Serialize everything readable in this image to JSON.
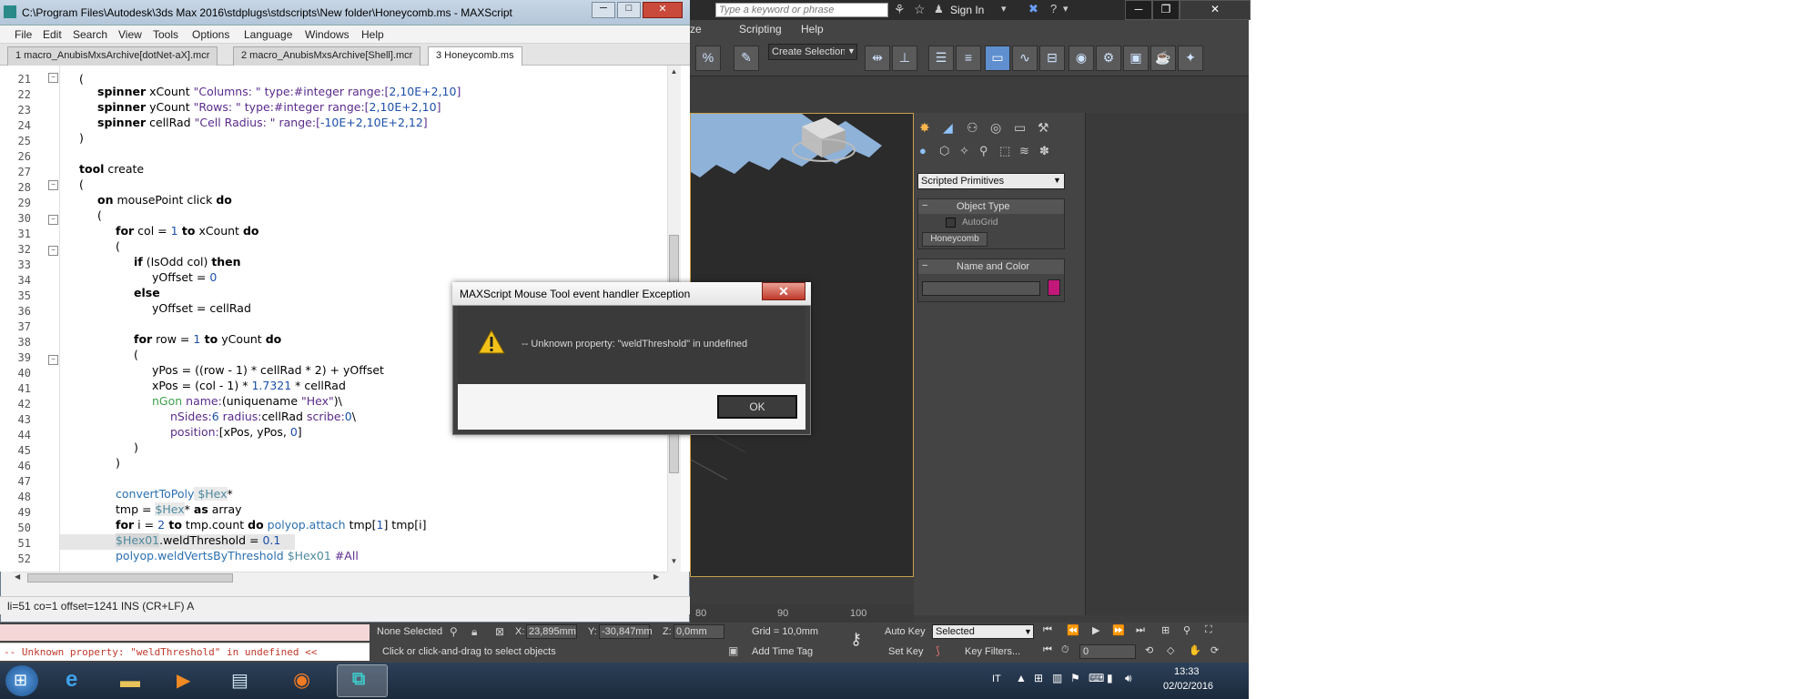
{
  "max": {
    "search_placeholder": "Type a keyword or phrase",
    "sign_in": "Sign In",
    "menu": [
      "Scripting",
      "Help"
    ],
    "selection_set": "Create Selection Se",
    "panel_dropdown": "Scripted Primitives",
    "object_type_header": "Object Type",
    "autogrid_label": "AutoGrid",
    "honeycomb_button": "Honeycomb",
    "name_color_header": "Name and Color",
    "name_color_swatch": "#c2187a",
    "ruler": [
      "80",
      "90",
      "100"
    ],
    "status": {
      "selection": "None Selected",
      "x_label": "X:",
      "x_value": "23,895mm",
      "y_label": "Y:",
      "y_value": "-30,847mm",
      "z_label": "Z:",
      "z_value": "0,0mm",
      "grid": "Grid = 10,0mm",
      "prompt": "Click or click-and-drag to select objects",
      "add_time_tag": "Add Time Tag",
      "auto_key": "Auto Key",
      "set_key": "Set Key",
      "selected_dropdown": "Selected",
      "key_filters": "Key Filters...",
      "frame": "0"
    },
    "listener_error": "-- Unknown property: \"weldThreshold\" in undefined <<"
  },
  "editor": {
    "title": "C:\\Program Files\\Autodesk\\3ds Max 2016\\stdplugs\\stdscripts\\New folder\\Honeycomb.ms - MAXScript",
    "menu": [
      "File",
      "Edit",
      "Search",
      "View",
      "Tools",
      "Options",
      "Language",
      "Windows",
      "Help"
    ],
    "tabs": [
      "1 macro_AnubisMxsArchive[dotNet-aX].mcr",
      "2 macro_AnubisMxsArchive[Shell].mcr",
      "3 Honeycomb.ms"
    ],
    "status": "li=51 co=1 offset=1241 INS (CR+LF) A",
    "line_numbers": [
      "21",
      "22",
      "23",
      "24",
      "25",
      "26",
      "27",
      "28",
      "29",
      "30",
      "31",
      "32",
      "33",
      "34",
      "35",
      "36",
      "37",
      "38",
      "39",
      "40",
      "41",
      "42",
      "43",
      "44",
      "45",
      "46",
      "47",
      "48",
      "49",
      "50",
      "51",
      "52"
    ],
    "code": {
      "l21": "(",
      "l22_kw": "spinner",
      "l22_name": " xCount ",
      "l22_str": "\"Columns: \"",
      "l22_type": " type:#integer range:[",
      "l22_nums": "2,10E+2,10",
      "l22_end": "]",
      "l23_kw": "spinner",
      "l23_name": " yCount ",
      "l23_str": "\"Rows: \"",
      "l23_type": " type:#integer range:[",
      "l23_nums": "2,10E+2,10",
      "l23_end": "]",
      "l24_kw": "spinner",
      "l24_name": " cellRad ",
      "l24_str": "\"Cell Radius: \"",
      "l24_type": " range:[",
      "l24_nums": "-10E+2,10E+2,12",
      "l24_end": "]",
      "l25": ")",
      "l27_kw": "tool",
      "l27_rest": " create",
      "l28": "(",
      "l29_kw1": "on",
      "l29_mid": " mousePoint click ",
      "l29_kw2": "do",
      "l30": "(",
      "l31_kw1": "for",
      "l31_a": " col = ",
      "l31_num": "1",
      "l31_kw2": " to",
      "l31_b": " xCount ",
      "l31_kw3": "do",
      "l32": "(",
      "l33_kw1": "if",
      "l33_a": " (IsOdd col) ",
      "l33_kw2": "then",
      "l34_a": "yOffset = ",
      "l34_num": "0",
      "l35_kw": "else",
      "l36": "yOffset = cellRad",
      "l38_kw1": "for",
      "l38_a": " row = ",
      "l38_num": "1",
      "l38_kw2": " to",
      "l38_b": " yCount ",
      "l38_kw3": "do",
      "l39": "(",
      "l40": "yPos = ((row - 1) * cellRad * 2) + yOffset",
      "l41_a": "xPos = (col - 1) * ",
      "l41_num": "1.7321",
      "l41_b": " * cellRad",
      "l42_fn": "nGon",
      "l42_a": " name:",
      "l42_b": "(uniquename ",
      "l42_str": "\"Hex\"",
      "l42_c": ")\\",
      "l43_a": "nSides:",
      "l43_n1": "6",
      "l43_b": " radius:",
      "l43_c": "cellRad",
      "l43_d": " scribe:",
      "l43_n2": "0",
      "l43_e": "\\",
      "l44_a": "position:",
      "l44_b": "[xPos, yPos, ",
      "l44_num": "0",
      "l44_c": "]",
      "l45": ")",
      "l46": ")",
      "l48_fn": "convertToPoly",
      "l48_nm": " $Hex",
      "l48_end": "*",
      "l49_a": "tmp = ",
      "l49_nm": "$Hex",
      "l49_b": "* ",
      "l49_kw": "as",
      "l49_c": " array",
      "l50_kw1": "for",
      "l50_a": " i = ",
      "l50_num": "2",
      "l50_kw2": " to",
      "l50_b": " tmp.count ",
      "l50_kw3": "do",
      "l50_fn": " polyop.attach",
      "l50_c": " tmp[",
      "l50_n1": "1",
      "l50_d": "] tmp[i]",
      "l51_nm": "$Hex01",
      "l51_a": ".weldThreshold = ",
      "l51_num": "0.1",
      "l52_fn": "polyop.weldVertsByThreshold",
      "l52_nm": " $Hex01",
      "l52_a": " #All"
    }
  },
  "dialog": {
    "title": "MAXScript Mouse Tool event handler Exception",
    "message": "-- Unknown property: \"weldThreshold\" in undefined",
    "ok": "OK",
    "close": "✕"
  },
  "taskbar": {
    "lang": "IT",
    "time": "13:33",
    "date": "02/02/2016"
  }
}
